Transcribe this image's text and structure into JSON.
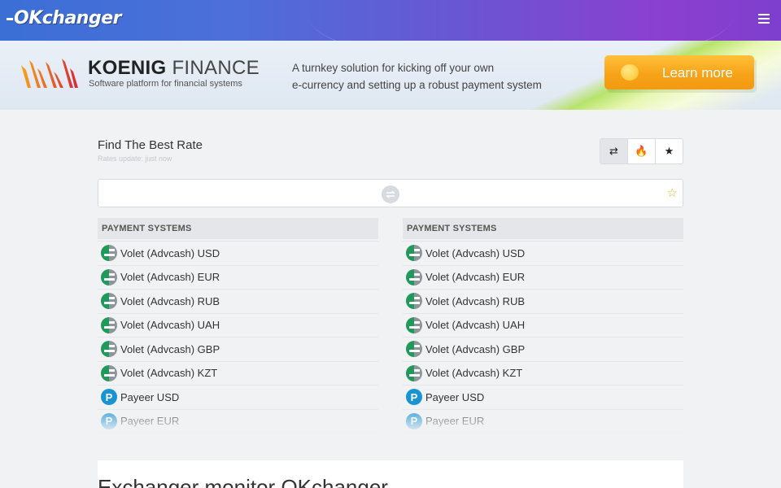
{
  "header": {
    "logo_text": "OKchanger",
    "menu_icon": "hamburger-icon"
  },
  "banner": {
    "brand_bold": "KOENIG",
    "brand_light": " FINANCE",
    "brand_tagline": "Software platform for financial systems",
    "text_line1": "A turnkey solution for kicking off your own",
    "text_line2": "e-currency and setting up a robust payment system",
    "cta_label": "Learn more",
    "colors": {
      "cta": "#f7a318",
      "accent": "#b7e36a"
    }
  },
  "finder": {
    "title": "Find The Best Rate",
    "subtitle": "Rates update: just now",
    "toggle_icons": [
      "swap-icon",
      "fire-icon",
      "star-icon"
    ],
    "toggle_glyphs": [
      "⇄",
      "🔥",
      "★"
    ],
    "search_icons": {
      "swap": "swap-icon",
      "favorite": "star-outline-icon"
    },
    "fav_glyph": "☆"
  },
  "lists": {
    "left": {
      "header": "PAYMENT SYSTEMS",
      "items": [
        {
          "label": "Volet (Advcash) USD",
          "icon": "volet-icon"
        },
        {
          "label": "Volet (Advcash) EUR",
          "icon": "volet-icon"
        },
        {
          "label": "Volet (Advcash) RUB",
          "icon": "volet-icon"
        },
        {
          "label": "Volet (Advcash) UAH",
          "icon": "volet-icon"
        },
        {
          "label": "Volet (Advcash) GBP",
          "icon": "volet-icon"
        },
        {
          "label": "Volet (Advcash) KZT",
          "icon": "volet-icon"
        },
        {
          "label": "Payeer USD",
          "icon": "payeer-icon"
        },
        {
          "label": "Payeer EUR",
          "icon": "payeer-icon"
        }
      ]
    },
    "right": {
      "header": "PAYMENT SYSTEMS",
      "items": [
        {
          "label": "Volet (Advcash) USD",
          "icon": "volet-icon"
        },
        {
          "label": "Volet (Advcash) EUR",
          "icon": "volet-icon"
        },
        {
          "label": "Volet (Advcash) RUB",
          "icon": "volet-icon"
        },
        {
          "label": "Volet (Advcash) UAH",
          "icon": "volet-icon"
        },
        {
          "label": "Volet (Advcash) GBP",
          "icon": "volet-icon"
        },
        {
          "label": "Volet (Advcash) KZT",
          "icon": "volet-icon"
        },
        {
          "label": "Payeer USD",
          "icon": "payeer-icon"
        },
        {
          "label": "Payeer EUR",
          "icon": "payeer-icon"
        }
      ]
    }
  },
  "main": {
    "section_title": "Exchanger monitor OKchanger"
  }
}
